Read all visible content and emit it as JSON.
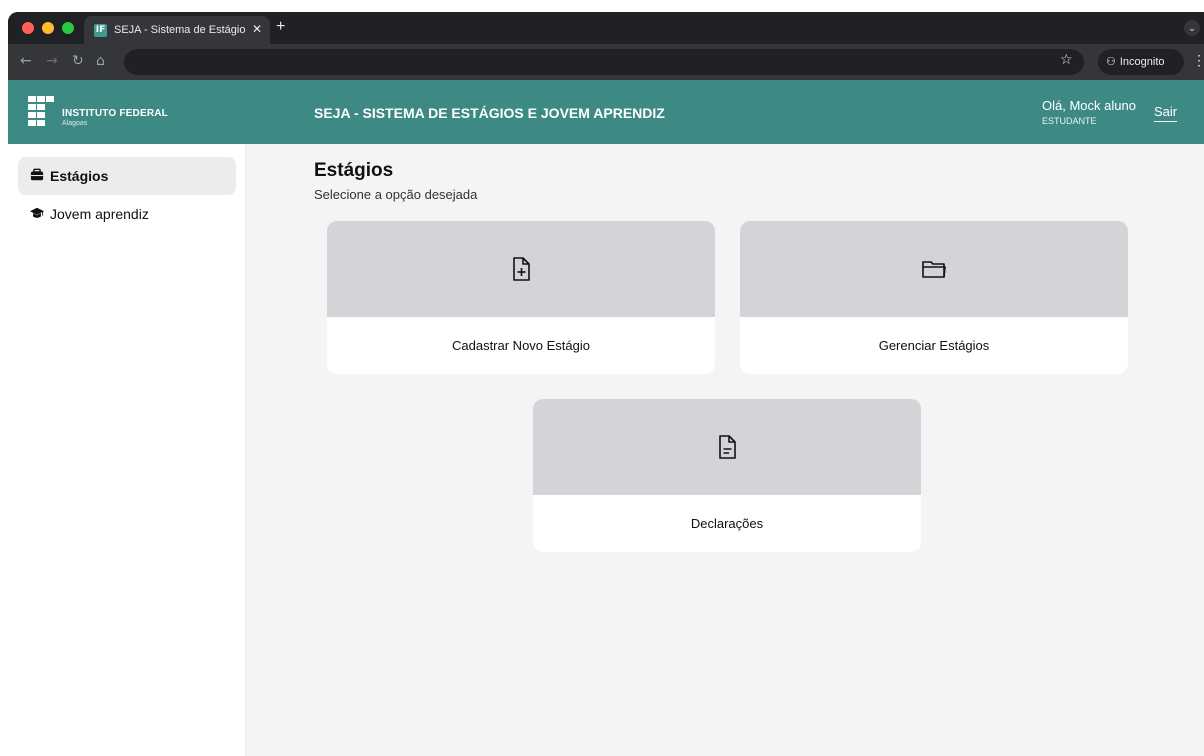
{
  "browser": {
    "tab_title": "SEJA - Sistema de Estágios e",
    "tab_favicon": "IF",
    "new_tab_label": "+",
    "incognito_label": "Incognito",
    "icons": [
      "close-icon",
      "back-icon",
      "forward-icon",
      "reload-icon",
      "home-icon",
      "star-icon",
      "incognito-icon",
      "kebab-menu-icon",
      "chevron-down-icon"
    ]
  },
  "header": {
    "logo_text": "INSTITUTO FEDERAL",
    "logo_sub": "Alagoas",
    "app_title": "SEJA - SISTEMA DE ESTÁGIOS E JOVEM APRENDIZ",
    "greeting": "Olá, Mock aluno",
    "role": "ESTUDANTE",
    "logout": "Sair",
    "background_color": "#3d8a85"
  },
  "sidebar": {
    "items": [
      {
        "label": "Estágios",
        "icon": "briefcase-icon",
        "active": true
      },
      {
        "label": "Jovem aprendiz",
        "icon": "graduation-cap-icon",
        "active": false
      }
    ]
  },
  "main": {
    "title": "Estágios",
    "subtitle": "Selecione a opção desejada",
    "cards": [
      {
        "label": "Cadastrar Novo Estágio",
        "icon": "file-plus-icon"
      },
      {
        "label": "Gerenciar Estágios",
        "icon": "folder-icon"
      },
      {
        "label": "Declarações",
        "icon": "file-text-icon"
      }
    ]
  }
}
